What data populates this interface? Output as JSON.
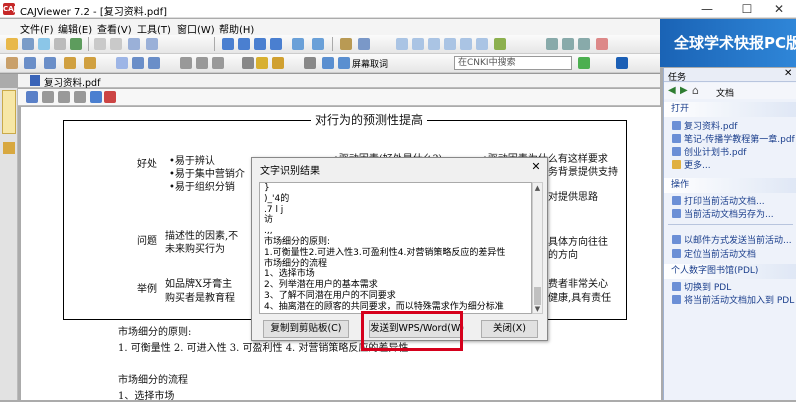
{
  "window": {
    "title": "CAJViewer 7.2 - [复习资料.pdf]",
    "minimize": "—",
    "maximize": "☐",
    "close": "✕",
    "app_icon_text": "CAJ"
  },
  "menu": [
    "文件(F)",
    "编辑(E)",
    "查看(V)",
    "工具(T)",
    "窗口(W)",
    "帮助(H)"
  ],
  "toolbar": {
    "layout_label": "屏幕取词",
    "search_placeholder": "在CNKI中搜索"
  },
  "banner": {
    "text": "全球学术快报PC版"
  },
  "document_tab": {
    "label": "复习资料.pdf"
  },
  "task_pane": {
    "title": "任务",
    "doc_label": "文档",
    "sections": [
      {
        "title": "打开",
        "items": [
          "复习资料.pdf",
          "笔记-传播学教程第一章.pdf",
          "创业计划书.pdf",
          "更多..."
        ]
      },
      {
        "title": "操作",
        "items": [
          "打印当前活动文档...",
          "当前活动文档另存为..."
        ]
      },
      {
        "title": "",
        "items": [
          "以邮件方式发送当前活动...",
          "定位当前活动文档"
        ]
      },
      {
        "title": "个人数字图书馆(PDL)",
        "items": [
          "切换到 PDL",
          "将当前活动文档加入到 PDL"
        ]
      }
    ]
  },
  "page": {
    "heading": "对行为的预测性提高",
    "row_labels": [
      "好处",
      "问题",
      "举例"
    ],
    "bullets_col1": [
      "•易于辨认",
      "•易于集中营销介"
    ],
    "bullets_col2": [
      "•驱动因素(好处是什么?)",
      "•驱动因素为什么有这样要求",
      "•易于组织分销"
    ],
    "fragments": [
      "务背景提供支持",
      "对提供思路",
      "描述性的因素,不",
      "未来购买行为",
      "具体方向往往",
      "的方向",
      "如品牌X牙膏主",
      "费者非常关心",
      "购买者是教育程",
      "健康,具有责任"
    ],
    "body_lines": [
      "市场细分的原则:",
      "1. 可衡量性  2. 可进入性  3. 可盈利性  4. 对营销策略反应的差异性",
      "市场细分的流程",
      "1、选择市场"
    ]
  },
  "dialog": {
    "title": "文字识别结果",
    "close": "✕",
    "text_lines": [
      "}",
      ")_'4的",
      ".7 l j",
      "访",
      ".,,",
      "市场细分的原则:",
      "1.可衡量性2.可进入性3.可盈利性4.对营销策略反应的差异性",
      "市场细分的流程",
      "1、选择市场",
      "2、列举潜在用户的基本需求",
      "3、了解不同潜在用户的不同要求",
      "4、抽离潜在的顾客的共同要求，而以特殊需求作为细分标准"
    ],
    "buttons": {
      "copy": "复制到剪贴板(C)",
      "send": "发送到WPS/Word(W)",
      "close": "关闭(X)"
    }
  }
}
